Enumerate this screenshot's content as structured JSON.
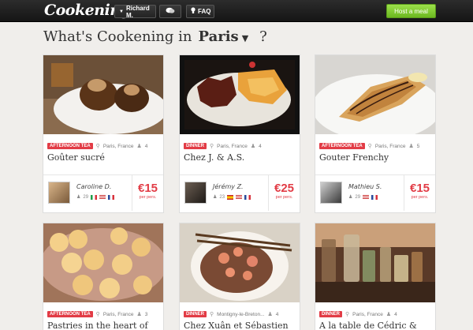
{
  "topbar": {
    "logo": "Cookening",
    "user_label": "Richard M.",
    "faq_label": "FAQ",
    "host_label": "Host a meal"
  },
  "heading": {
    "prefix": "What's Cookening in",
    "city": "Paris",
    "suffix": "?"
  },
  "cards": [
    {
      "tag": "Afternoon tea",
      "location": "Paris, France",
      "guests": "4",
      "title": "Goûter sucré",
      "host_name": "Caroline D.",
      "host_count": "29",
      "price": "€15",
      "per": "per pers."
    },
    {
      "tag": "Dinner",
      "location": "Paris, France",
      "guests": "4",
      "title": "Chez J. & A.S.",
      "host_name": "Jérémy Z.",
      "host_count": "23",
      "price": "€25",
      "per": "per pers."
    },
    {
      "tag": "Afternoon tea",
      "location": "Paris, France",
      "guests": "5",
      "title": "Gouter Frenchy",
      "host_name": "Mathieu S.",
      "host_count": "29",
      "price": "€15",
      "per": "per pers."
    },
    {
      "tag": "Afternoon tea",
      "location": "Paris, France",
      "guests": "3",
      "title": "Pastries in the heart of"
    },
    {
      "tag": "Dinner",
      "location": "Montigny-le-Breton...",
      "guests": "4",
      "title": "Chez Xuân et Sébastien"
    },
    {
      "tag": "Dinner",
      "location": "Paris, France",
      "guests": "4",
      "title": "A la table de Cédric &"
    }
  ]
}
